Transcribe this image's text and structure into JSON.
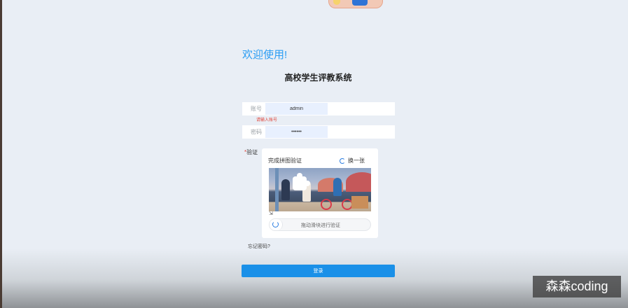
{
  "header": {
    "welcome": "欢迎使用!",
    "system_title": "高校学生评教系统"
  },
  "login": {
    "account_label": "账号",
    "account_value": "admin",
    "account_error": "请输入账号",
    "password_label": "密码",
    "password_value": "••••••",
    "captcha_label": "验证",
    "forgot_password": "忘记密码?",
    "login_button": "登录"
  },
  "captcha": {
    "title": "完成拼图验证",
    "refresh_label": "换一张",
    "slider_hint": "拖动滑块进行验证"
  },
  "watermark": "森森coding",
  "colors": {
    "accent": "#1a90e8",
    "welcome": "#2a9df4",
    "error": "#e0453a",
    "background": "#e9eef5"
  }
}
